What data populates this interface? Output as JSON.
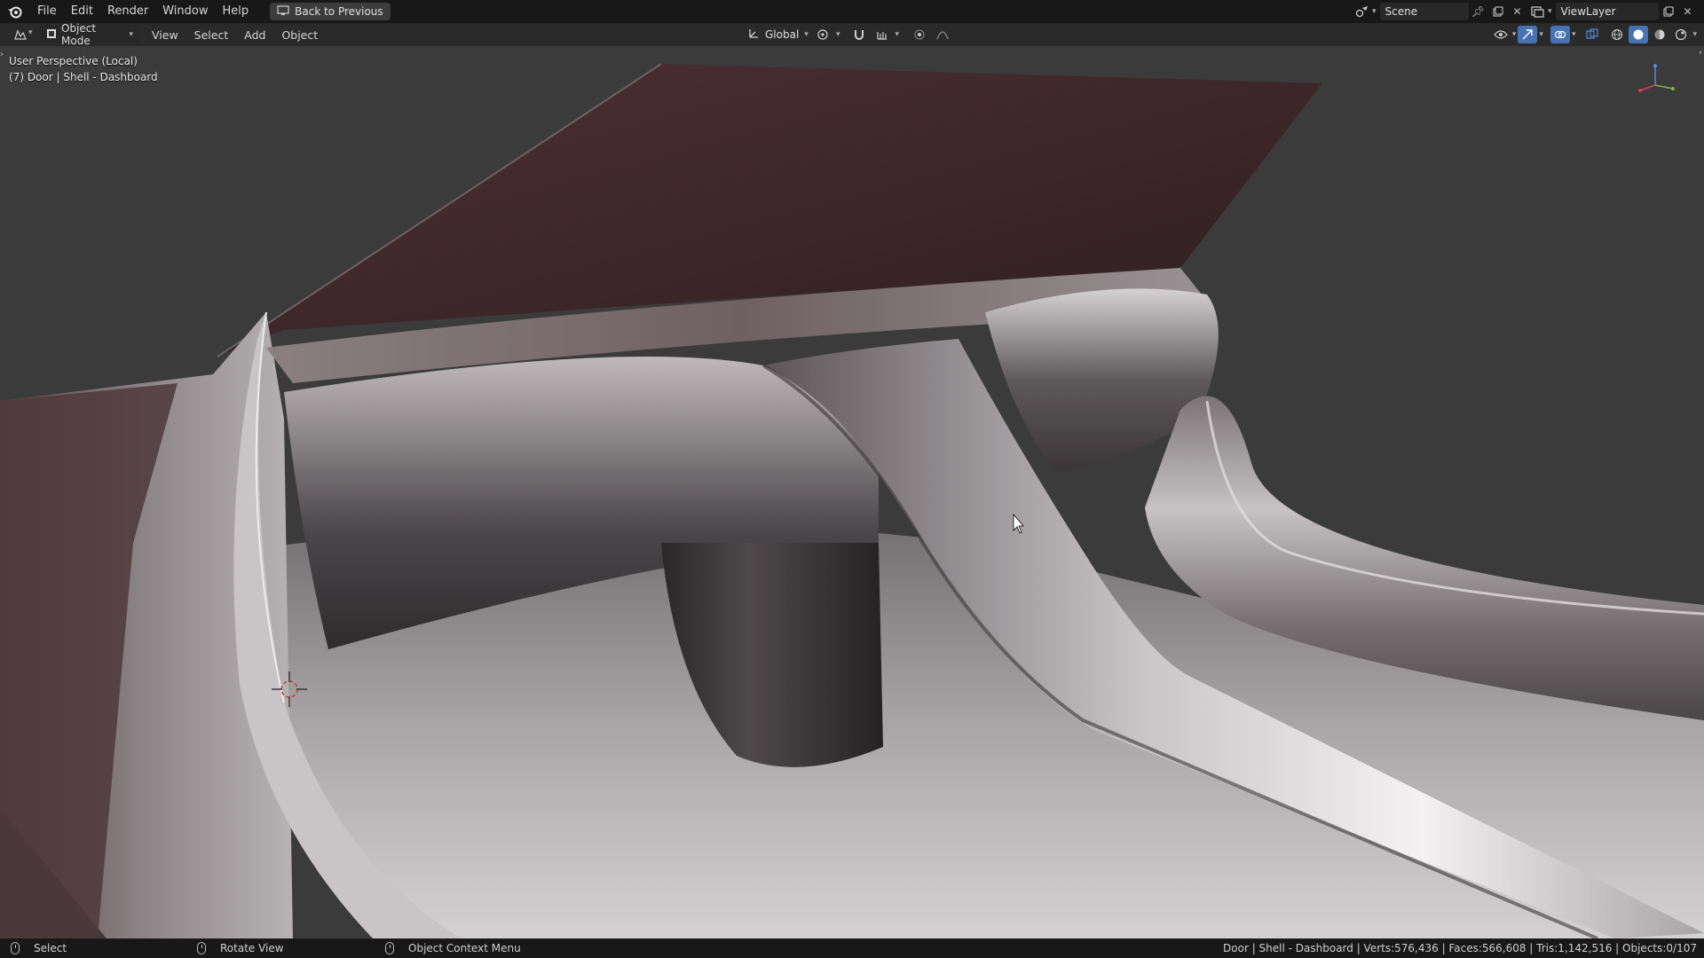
{
  "topbar": {
    "logo_icon": "blender-logo-icon",
    "menus": [
      "File",
      "Edit",
      "Render",
      "Window",
      "Help"
    ],
    "back_button": "Back to Previous",
    "scene": {
      "label": "Scene"
    },
    "view_layer": {
      "label": "ViewLayer"
    }
  },
  "header": {
    "mode": "Object Mode",
    "menus": [
      "View",
      "Select",
      "Add",
      "Object"
    ],
    "transform_orientation": "Global"
  },
  "viewport": {
    "perspective": "User Perspective (Local)",
    "object_info": "(7) Door | Shell - Dashboard"
  },
  "statusbar": {
    "hints": [
      {
        "label": "Select",
        "icon": "mouse-left-icon"
      },
      {
        "label": "Rotate View",
        "icon": "mouse-middle-icon"
      },
      {
        "label": "Object Context Menu",
        "icon": "mouse-right-icon"
      }
    ],
    "stats": "Door | Shell - Dashboard | Verts:576,436 | Faces:566,608 | Tris:1,142,516 | Objects:0/107"
  },
  "colors": {
    "accent": "#4772b3",
    "background": "#3b3b3b",
    "topbar": "#181818"
  }
}
